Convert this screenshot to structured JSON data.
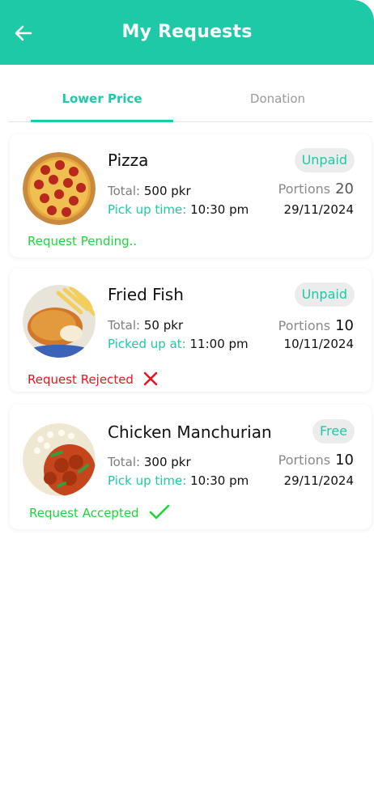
{
  "header": {
    "title": "My Requests",
    "back_icon": "arrow-left-icon"
  },
  "tabs": [
    {
      "label": "Lower Price",
      "active": true
    },
    {
      "label": "Donation",
      "active": false
    }
  ],
  "colors": {
    "accent": "#1dc9a6",
    "pending": "#1ed43a",
    "rejected": "#e8141e",
    "accepted": "#1ed43a"
  },
  "requests": [
    {
      "name": "Pizza",
      "badge": "Unpaid",
      "total_label": "Total:",
      "total": "500 pkr",
      "time_label": "Pick up time:",
      "time": "10:30 pm",
      "portions_label": "Portions",
      "portions": "20",
      "date": "29/11/2024",
      "status": "Request Pending..",
      "status_icon": ""
    },
    {
      "name": "Fried Fish",
      "badge": "Unpaid",
      "total_label": "Total:",
      "total": "50 pkr",
      "time_label": "Picked up at:",
      "time": "11:00 pm",
      "portions_label": "Portions",
      "portions": "10",
      "date": "10/11/2024",
      "status": "Request Rejected",
      "status_icon": "cross-icon"
    },
    {
      "name": "Chicken Manchurian",
      "badge": "Free",
      "total_label": "Total:",
      "total": "300 pkr",
      "time_label": "Pick up time:",
      "time": "10:30 pm",
      "portions_label": "Portions",
      "portions": "10",
      "date": "29/11/2024",
      "status": "Request Accepted",
      "status_icon": "check-icon"
    }
  ]
}
